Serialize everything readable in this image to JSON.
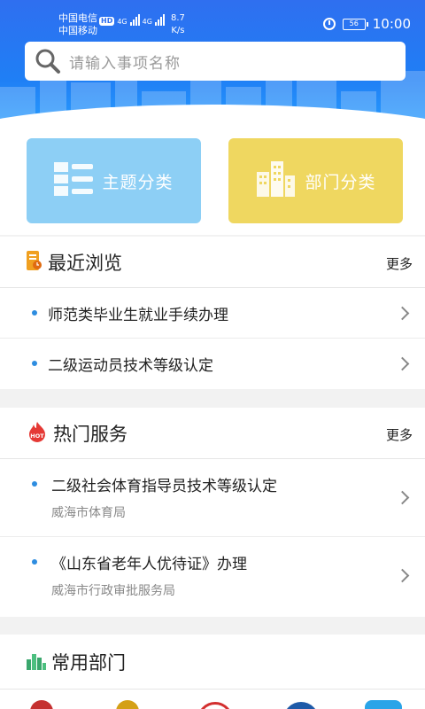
{
  "status_bar": {
    "carrier1": "中国电信",
    "carrier2": "中国移动",
    "hd": "HD",
    "net1": "4G",
    "net2": "4G",
    "speed_value": "8.7",
    "speed_unit": "K/s",
    "battery": "56",
    "time": "10:00"
  },
  "search": {
    "placeholder": "请输入事项名称"
  },
  "categories": {
    "theme": "主题分类",
    "dept": "部门分类"
  },
  "recent": {
    "title": "最近浏览",
    "more": "更多",
    "items": [
      {
        "title": "师范类毕业生就业手续办理"
      },
      {
        "title": "二级运动员技术等级认定"
      }
    ]
  },
  "hot": {
    "title": "热门服务",
    "more": "更多",
    "badge": "HOT",
    "items": [
      {
        "title": "二级社会体育指导员技术等级认定",
        "dept": "威海市体育局"
      },
      {
        "title": "《山东省老年人优待证》办理",
        "dept": "威海市行政审批服务局"
      }
    ]
  },
  "common": {
    "title": "常用部门"
  },
  "colors": {
    "accent": "#2e8de0",
    "theme_card": "#8dcff5",
    "dept_card": "#efd760",
    "header": "#2f6ff0"
  }
}
